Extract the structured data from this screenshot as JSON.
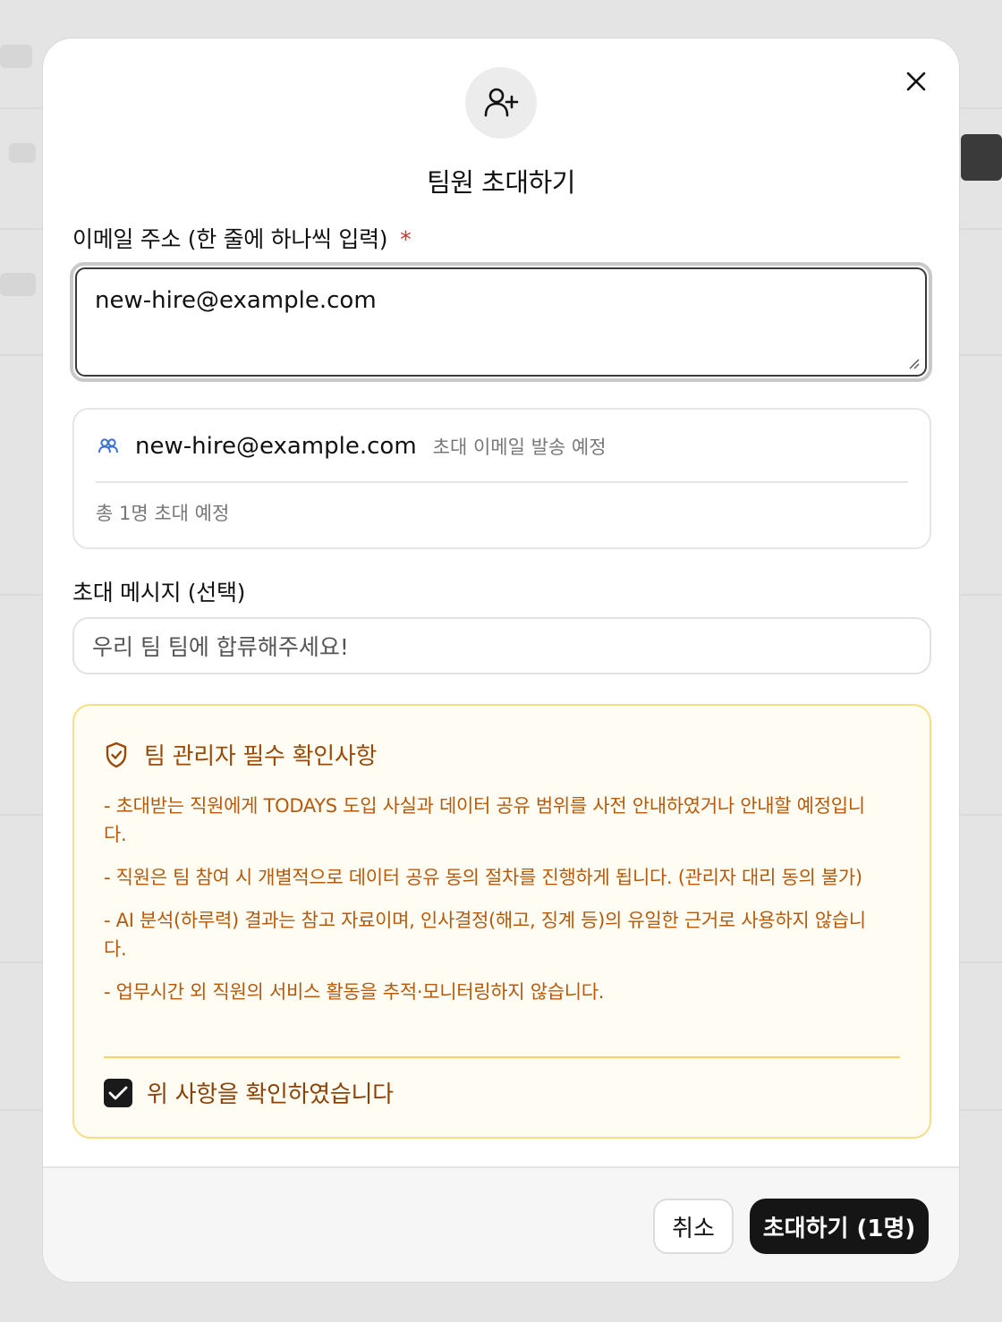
{
  "modal": {
    "title": "팀원 초대하기",
    "email_label": "이메일 주소 (한 줄에 하나씩 입력)",
    "required_mark": "*",
    "email_value": "new-hire@example.com",
    "preview": {
      "items": [
        {
          "email": "new-hire@example.com",
          "status": "초대 이메일 발송 예정"
        }
      ],
      "total": "총 1명 초대 예정"
    },
    "message_label": "초대 메시지 (선택)",
    "message_placeholder": "우리 팀 팀에 합류해주세요!",
    "notice": {
      "title": "팀 관리자 필수 확인사항",
      "items": [
        "- 초대받는 직원에게 TODAYS 도입 사실과 데이터 공유 범위를 사전 안내하였거나 안내할 예정입니다.",
        "- 직원은 팀 참여 시 개별적으로 데이터 공유 동의 절차를 진행하게 됩니다. (관리자 대리 동의 불가)",
        "- AI 분석(하루력) 결과는 참고 자료이며, 인사결정(해고, 징계 등)의 유일한 근거로 사용하지 않습니다.",
        "- 업무시간 외 직원의 서비스 활동을 추적·모니터링하지 않습니다."
      ],
      "confirm_label": "위 사항을 확인하였습니다",
      "confirm_checked": true
    },
    "footer": {
      "cancel_label": "취소",
      "submit_label": "초대하기 (1명)"
    }
  },
  "colors": {
    "accent_dark": "#151515",
    "notice_bg": "#fffdf3",
    "notice_border": "#f6de84",
    "notice_text": "#b55a0c",
    "required": "#d32f2f",
    "preview_icon": "#3b6fd8"
  },
  "icons": {
    "header": "user-plus-icon",
    "close": "close-icon",
    "preview": "users-icon",
    "notice": "shield-check-icon",
    "checkbox": "check-icon"
  }
}
